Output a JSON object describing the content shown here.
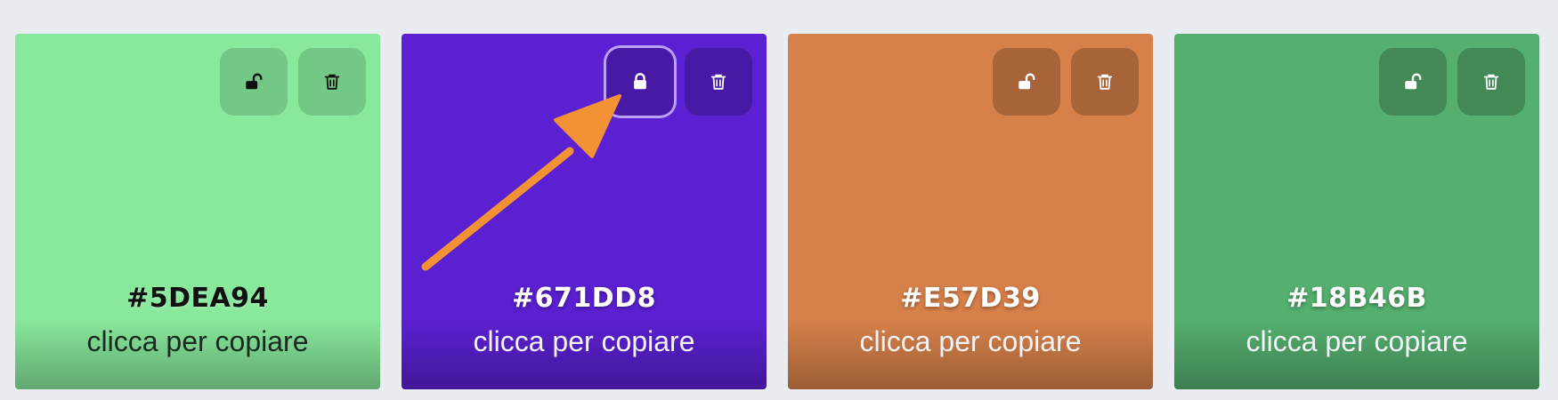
{
  "cards": [
    {
      "hex": "#5DEA94",
      "bg": "#88E99C",
      "hint": "clicca per copiare",
      "lock_state": "unlocked",
      "lock_icon": "unlock-icon",
      "trash_icon": "trash-icon",
      "tone": "light"
    },
    {
      "hex": "#671DD8",
      "bg": "#5B20D2",
      "hint": "clicca per copiare",
      "lock_state": "locked",
      "lock_icon": "lock-icon",
      "trash_icon": "trash-icon",
      "tone": "dark"
    },
    {
      "hex": "#E57D39",
      "bg": "#D7814A",
      "hint": "clicca per copiare",
      "lock_state": "unlocked",
      "lock_icon": "unlock-icon",
      "trash_icon": "trash-icon",
      "tone": "dark"
    },
    {
      "hex": "#18B46B",
      "bg": "#55B06F",
      "hint": "clicca per copiare",
      "lock_state": "unlocked",
      "lock_icon": "unlock-icon",
      "trash_icon": "trash-icon",
      "tone": "dark"
    }
  ],
  "annotation": {
    "color": "#F29234",
    "icon": "arrow-annotation"
  },
  "page_background": "#E9EDF2"
}
